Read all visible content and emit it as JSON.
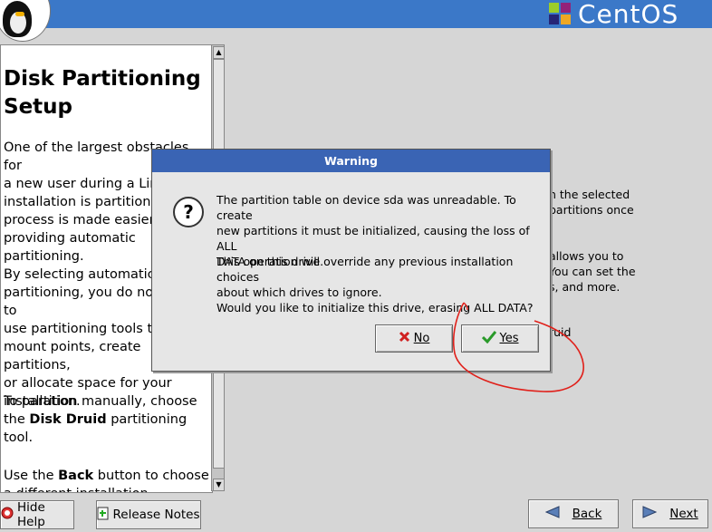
{
  "header": {
    "brand": "CentOS"
  },
  "help": {
    "title": "Disk Partitioning Setup",
    "paragraphs": [
      "One of the largest obstacles for\na new user during a Linux\ninstallation is partitioning. This\nprocess is made easier by\nproviding automatic\npartitioning.",
      "By selecting automatic\npartitioning, you do not have to\nuse partitioning tools to assign\nmount points, create partitions,\nor allocate space for your\ninstallation.",
      "To partition manually, choose\nthe ",
      "Use the "
    ],
    "p3_bold": "Disk Druid",
    "p3_tail": " partitioning\ntool.",
    "p4_bold": "Back",
    "p4_tail": " button to choose\na different installation"
  },
  "background": {
    "line1": "n the selected\npartitions once",
    "line2": "allows you to\nYou can set the\ns, and more.",
    "line3": "ruid"
  },
  "dialog": {
    "title": "Warning",
    "message1": "The partition table on device sda was unreadable. To create\nnew partitions it must be initialized, causing the loss of ALL\nDATA on this drive.",
    "message2": "This operation will override any previous installation choices\nabout which drives to ignore.",
    "message3": "Would you like to initialize this drive, erasing ALL DATA?",
    "no_label": "No",
    "yes_label": "Yes"
  },
  "buttons": {
    "hide_help": "Hide Help",
    "release_notes": "Release Notes",
    "back": "Back",
    "next": "Next"
  },
  "colors": {
    "topbar": "#3b78c8",
    "dialog_title": "#3a64b4",
    "annotation": "#e0201a"
  }
}
